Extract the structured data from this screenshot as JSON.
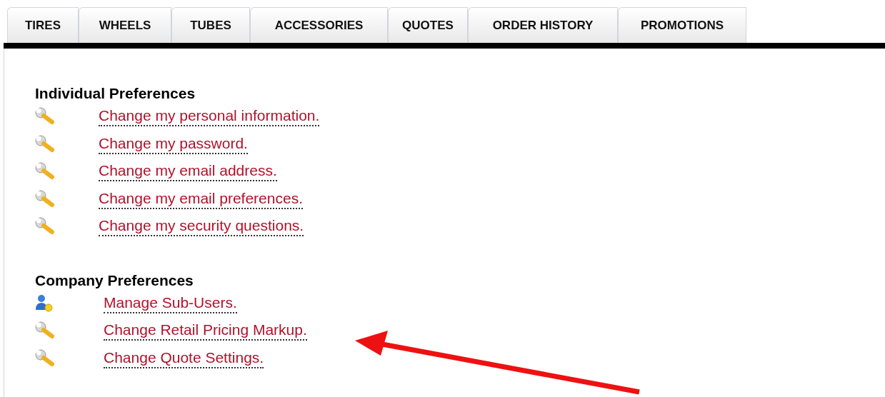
{
  "tabs": [
    {
      "label": "TIRES",
      "selected": false
    },
    {
      "label": "WHEELS",
      "selected": false
    },
    {
      "label": "TUBES",
      "selected": false
    },
    {
      "label": "ACCESSORIES",
      "selected": false
    },
    {
      "label": "QUOTES",
      "selected": false
    },
    {
      "label": "ORDER HISTORY",
      "selected": false
    },
    {
      "label": "PROMOTIONS",
      "selected": false
    }
  ],
  "sections": [
    {
      "heading": "Individual Preferences",
      "items": [
        {
          "kind": "wrench",
          "label": "Change my personal information."
        },
        {
          "kind": "wrench",
          "label": "Change my password."
        },
        {
          "kind": "wrench",
          "label": "Change my email address."
        },
        {
          "kind": "wrench",
          "label": "Change my email preferences."
        },
        {
          "kind": "wrench",
          "label": "Change my security questions."
        }
      ]
    },
    {
      "heading": "Company Preferences",
      "items": [
        {
          "kind": "user",
          "label": "Manage Sub-Users."
        },
        {
          "kind": "wrench",
          "label": "Change Retail Pricing Markup."
        },
        {
          "kind": "wrench",
          "label": "Change Quote Settings."
        }
      ]
    }
  ]
}
